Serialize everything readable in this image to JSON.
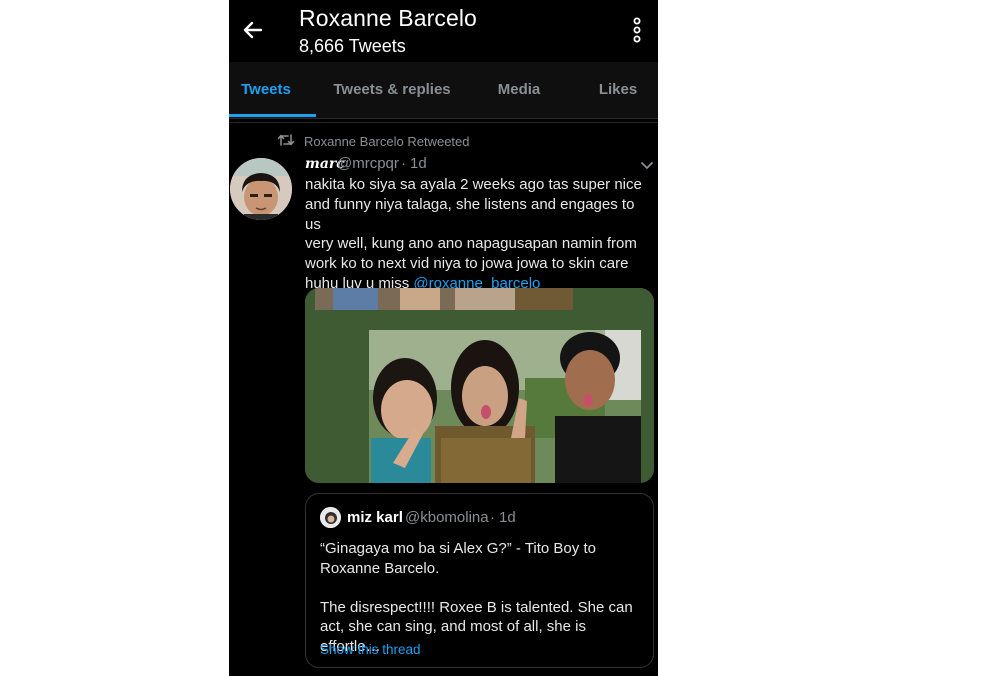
{
  "header": {
    "title": "Roxanne Barcelo",
    "tweet_count": "8,666 Tweets",
    "back_icon": "arrow-left-icon",
    "more_icon": "more-vertical-icon"
  },
  "tabs": [
    {
      "label": "Tweets",
      "active": true
    },
    {
      "label": "Tweets & replies",
      "active": false
    },
    {
      "label": "Media",
      "active": false
    },
    {
      "label": "Likes",
      "active": false
    }
  ],
  "tweet": {
    "retweet_context": "Roxanne Barcelo Retweeted",
    "author_name": "marc",
    "author_handle": "@mrcpqr",
    "separator": "·",
    "time": "1d",
    "text_lines": [
      "nakita ko siya sa ayala 2 weeks ago tas super nice",
      "and funny niya talaga, she listens and engages to us",
      "very well, kung ano ano napagusapan namin from",
      "work ko to next vid niya to jowa jowa to skin care",
      "huhu luv u miss "
    ],
    "mention": "@roxanne_barcelo",
    "quote": {
      "author_name": "miz karl",
      "author_handle": "@kbomolina",
      "separator": "·",
      "time": "1d",
      "paragraph1": "“Ginagaya mo ba si Alex G?” - Tito Boy to Roxanne Barcelo.",
      "paragraph2": "The disrespect!!!! Roxee B is talented. She can act, she can sing, and most of all, she is effortle…",
      "show_thread": "Show this thread"
    }
  },
  "colors": {
    "accent": "#1da1f2",
    "background": "#000000",
    "muted_text": "#8a8f93"
  }
}
